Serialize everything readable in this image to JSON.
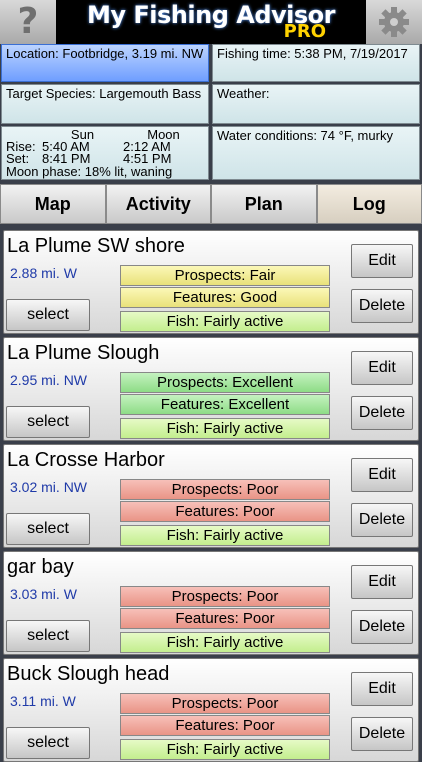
{
  "header": {
    "title": "My Fishing Advisor",
    "edition": "PRO",
    "help_icon": "question-mark-icon",
    "settings_icon": "gear-icon"
  },
  "info": {
    "location": "Location: Footbridge, 3.19 mi. NW",
    "fishing_time": "Fishing time: 5:38 PM, 7/19/2017",
    "target_species": "Target Species: Largemouth Bass",
    "weather": "Weather:",
    "sun_header": "Sun",
    "moon_header": "Moon",
    "rise_label": "Rise:",
    "set_label": "Set:",
    "sun_rise": "5:40 AM",
    "moon_rise": "2:12 AM",
    "sun_set": "8:41 PM",
    "moon_set": "4:51 PM",
    "moon_phase": "Moon phase: 18% lit, waning",
    "water": "Water conditions: 74 °F, murky"
  },
  "tabs": [
    "Map",
    "Activity",
    "Plan",
    "Log"
  ],
  "labels": {
    "select": "select",
    "edit": "Edit",
    "delete": "Delete"
  },
  "spots": [
    {
      "name": "La Plume SW shore",
      "distance": "2.88 mi. W",
      "prospects": "Prospects: Fair",
      "features": "Features: Good",
      "fish": "Fish: Fairly active"
    },
    {
      "name": "La Plume Slough",
      "distance": "2.95 mi. NW",
      "prospects": "Prospects: Excellent",
      "features": "Features: Excellent",
      "fish": "Fish: Fairly active"
    },
    {
      "name": "La Crosse Harbor",
      "distance": "3.02 mi. NW",
      "prospects": "Prospects: Poor",
      "features": "Features: Poor",
      "fish": "Fish: Fairly active"
    },
    {
      "name": "gar bay",
      "distance": "3.03 mi. W",
      "prospects": "Prospects: Poor",
      "features": "Features: Poor",
      "fish": "Fish: Fairly active"
    },
    {
      "name": "Buck Slough head",
      "distance": "3.11 mi. W",
      "prospects": "Prospects: Poor",
      "features": "Features: Poor",
      "fish": "Fish: Fairly active"
    }
  ],
  "colors": {
    "fair": "#f1ec98",
    "good": "#f1ec98",
    "excellent": "#a6e59f",
    "poor": "#f0a89c",
    "active": "#d4f3a8",
    "location_highlight": "#8fb5ff"
  }
}
